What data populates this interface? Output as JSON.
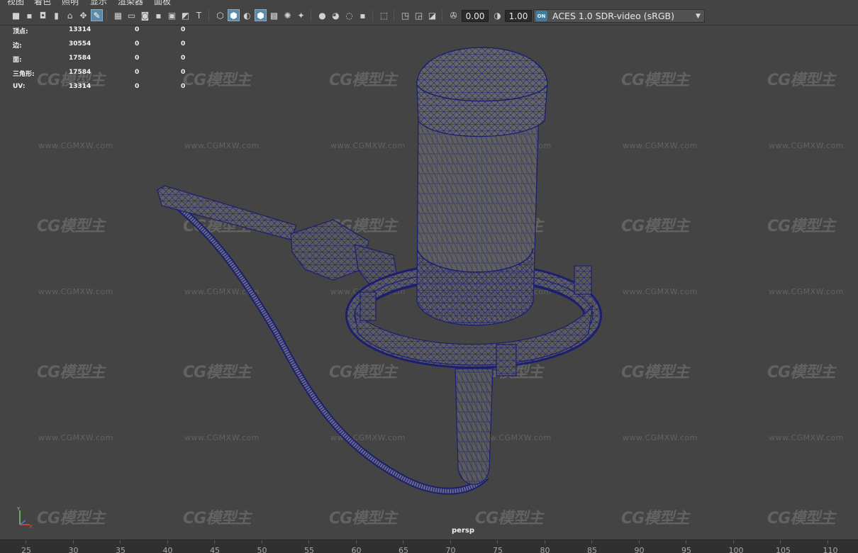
{
  "menu": {
    "items": [
      "视图",
      "着色",
      "照明",
      "显示",
      "渲染器",
      "面板"
    ]
  },
  "toolbar": {
    "exposure_value": "0.00",
    "gamma_value": "1.00",
    "color_space_label": "ACES 1.0 SDR-video (sRGB)",
    "color_space_toggle": "ON",
    "icons": [
      "camera-select-icon",
      "camera-attributes-icon",
      "bookmarks-icon",
      "image-plane-icon",
      "grease-pencil-icon",
      "2d-pan-zoom-icon",
      "grid-icon",
      "film-gate-icon",
      "resolution-gate-icon",
      "gate-mask-icon",
      "field-chart-icon",
      "safe-action-icon",
      "safe-title-icon",
      "wireframe-icon",
      "smooth-shade-icon",
      "default-material-icon",
      "wireframe-on-shaded-icon",
      "textured-icon",
      "use-all-lights-icon",
      "shadows-icon",
      "screen-space-ao-icon",
      "motion-blur-icon",
      "multisample-aa-icon",
      "depth-of-field-icon",
      "isolate-select-icon",
      "xray-icon",
      "xray-active-components-icon",
      "xray-joints-icon",
      "exposure-icon",
      "gamma-icon"
    ]
  },
  "hud": {
    "rows": [
      {
        "label": "顶点:",
        "total": "13314",
        "selected": "0",
        "components": "0"
      },
      {
        "label": "边:",
        "total": "30554",
        "selected": "0",
        "components": "0"
      },
      {
        "label": "面:",
        "total": "17584",
        "selected": "0",
        "components": "0"
      },
      {
        "label": "三角形:",
        "total": "17584",
        "selected": "0",
        "components": "0"
      },
      {
        "label": "UV:",
        "total": "13314",
        "selected": "0",
        "components": "0"
      }
    ]
  },
  "viewport": {
    "camera_label": "persp",
    "wireframe_color": "#1c1f6e",
    "shaded_color": "#5c5c5c",
    "background_color": "#444444"
  },
  "watermark": {
    "logo_text": "CG模型主",
    "url_text": "www.CGMXW.com"
  },
  "timeline": {
    "ticks": [
      "25",
      "30",
      "35",
      "40",
      "45",
      "50",
      "55",
      "60",
      "65",
      "70",
      "75",
      "80",
      "85",
      "90",
      "95",
      "100",
      "105",
      "110"
    ]
  }
}
